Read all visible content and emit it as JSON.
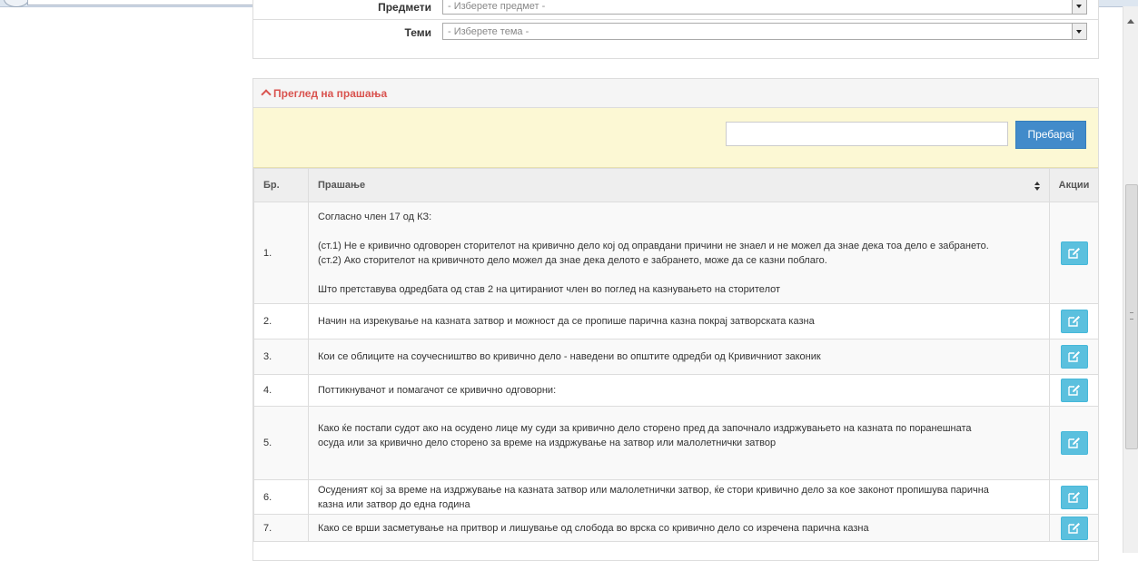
{
  "filters": {
    "subject": {
      "label": "Предмети",
      "placeholder": "- Изберете предмет -"
    },
    "topic": {
      "label": "Теми",
      "placeholder": "- Изберете тема -"
    }
  },
  "questions_panel": {
    "title": "Преглед на прашања",
    "search": {
      "value": "",
      "button_label": "Пребарај"
    },
    "columns": {
      "number": "Бр.",
      "question": "Прашање",
      "actions": "Акции"
    },
    "rows": [
      {
        "number": "1.",
        "lines": [
          "Согласно член 17 од КЗ:",
          "",
          "(ст.1) Не е кривично одговорен сторителот на кривично дело кој од оправдани причини не знаел и не можел да знае дека тоа дело е забрането.",
          "(ст.2)  Ако сторителот на кривичното дело можел да знае дека делото е забрането, може да се казни поблаго.",
          "",
          "Што претставува одредбата од став 2 на цитираниот член во поглед на казнувањето на сторителот"
        ]
      },
      {
        "number": "2.",
        "lines": [
          "Начин на изрекување на казната затвор и можност да се пропише парична казна покрај затворската казна"
        ]
      },
      {
        "number": "3.",
        "lines": [
          "Кои се облиците на соучесништво во кривично дело - наведени во општите одредби од Кривичниот законик"
        ]
      },
      {
        "number": "4.",
        "lines": [
          "Поттикнувачот и помагачот се кривично одговорни:"
        ]
      },
      {
        "number": "5.",
        "lines": [
          "Како ќе постапи судот ако на осудено лице му суди за кривично дело сторено пред да започнало издржувањето на казната по поранешната",
          "осуда или за кривично дело сторено за време на издржување на затвор или малолетнички затвор",
          ""
        ]
      },
      {
        "number": "6.",
        "lines": [
          "Осуденият кој за време на издржување на казната затвор или малолетнички затвор, ќе стори кривично дело за кое законот пропишува парична",
          "казна или затвор до една година"
        ]
      },
      {
        "number": "7.",
        "lines": [
          "Како се врши засметување на притвор и лишување од слобода во врска со кривично дело со изречена парична казна"
        ]
      }
    ]
  },
  "icons": {
    "edit": "edit-icon",
    "collapse": "chevron-up-icon",
    "sort": "sort-icon"
  },
  "colors": {
    "accent": "#d9534f",
    "primary": "#428bca",
    "info": "#5bc0de",
    "search_bg": "#fcf8d4"
  }
}
